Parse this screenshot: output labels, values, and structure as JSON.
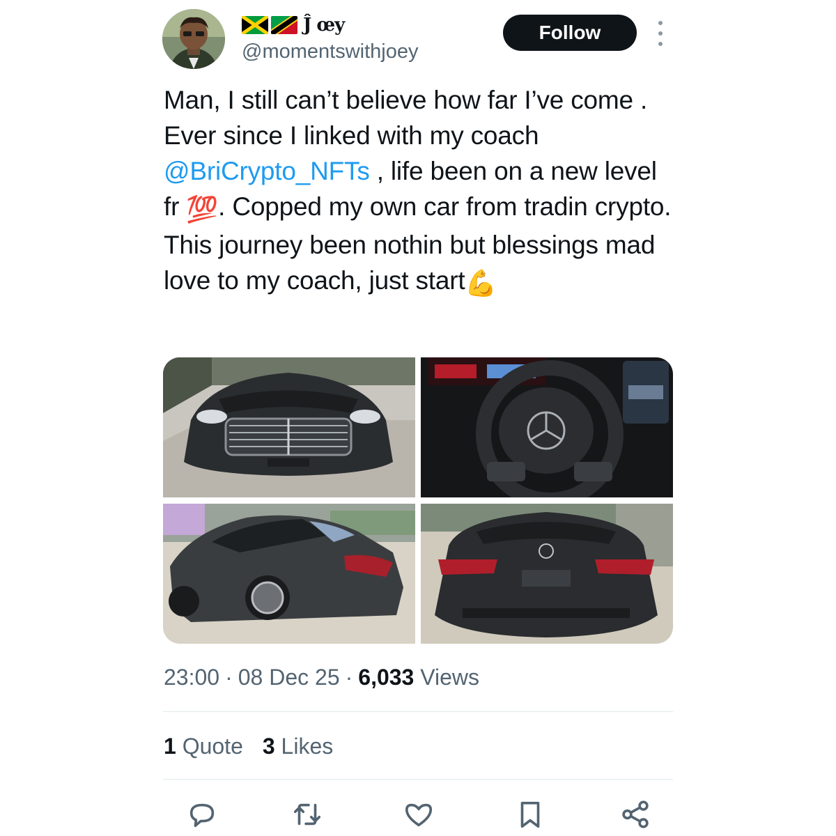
{
  "user": {
    "display_name": "Ĵ œy",
    "handle": "@momentswithjoey",
    "follow_label": "Follow"
  },
  "tweet": {
    "part1": "Man, I still can’t believe how far I’ve come . Ever since I linked with my coach ",
    "mention": "@BriCrypto_NFTs",
    "part2": " , life been on a new level fr ",
    "emoji1": "💯",
    "part3": ". Copped my own car from tradin crypto. This journey been nothin but blessings mad love to my coach, just start",
    "emoji2": "💪"
  },
  "meta": {
    "time": "23:00",
    "date": "08 Dec 25",
    "views_count": "6,033",
    "views_label": "Views",
    "sep": "·"
  },
  "stats": {
    "quotes_count": "1",
    "quotes_label": "Quote",
    "likes_count": "3",
    "likes_label": "Likes"
  },
  "icons": {
    "reply": "reply-icon",
    "retweet": "retweet-icon",
    "like": "heart-icon",
    "bookmark": "bookmark-icon",
    "share": "share-icon"
  },
  "colors": {
    "mention": "#1d9bf0",
    "secondary_text": "#536471",
    "follow_bg": "#0f1419"
  }
}
